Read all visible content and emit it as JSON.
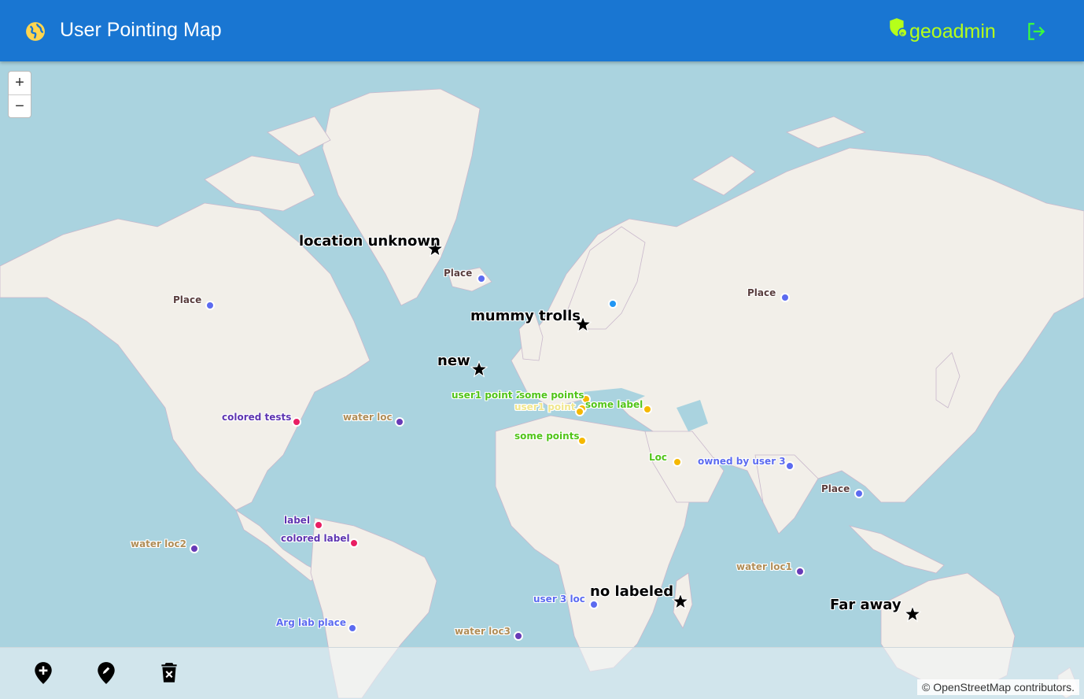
{
  "header": {
    "title": "User Pointing Map",
    "username": "geoadmin",
    "globe_icon": "globe-icon",
    "user_icon": "admin-badge-icon",
    "logout_icon": "logout-icon",
    "colors": {
      "bar": "#1976d2",
      "username": "#b6ff1a",
      "logout": "#3bff3b",
      "globe": "#ffd54f"
    }
  },
  "zoom": {
    "in": "+",
    "out": "−"
  },
  "markers": [
    {
      "label": "location unknown",
      "style": "star"
    },
    {
      "label": "Place",
      "style": "dot",
      "color": "#5c6bf0",
      "label_color": "#5a3e3e"
    },
    {
      "label": "Place",
      "style": "dot",
      "color": "#5c6bf0",
      "label_color": "#5a3e3e"
    },
    {
      "label": "mummy trolls",
      "style": "star"
    },
    {
      "label": "",
      "style": "dot",
      "color": "#2196f3"
    },
    {
      "label": "Place",
      "style": "dot",
      "color": "#5c6bf0",
      "label_color": "#5a3e3e"
    },
    {
      "label": "new",
      "style": "star"
    },
    {
      "label": "user1 point 2",
      "style": "dot",
      "color": "#f5b800",
      "label_color": "#52c41a"
    },
    {
      "label": "some points",
      "style": "dot",
      "color": "#f5b800",
      "label_color": "#52c41a"
    },
    {
      "label": "user1 point",
      "style": "dot",
      "color": "#f5b800",
      "label_color": "#f0e68c"
    },
    {
      "label": "some label",
      "style": "dot",
      "color": "#f5b800",
      "label_color": "#52c41a"
    },
    {
      "label": "colored tests",
      "style": "dot",
      "color": "#e91e63",
      "label_color": "#5e35b1"
    },
    {
      "label": "water loc",
      "style": "dot",
      "color": "#673ab7",
      "label_color": "#b08d57"
    },
    {
      "label": "some points",
      "style": "dot",
      "color": "#f5b800",
      "label_color": "#52c41a"
    },
    {
      "label": "Loc",
      "style": "dot",
      "color": "#f5b800",
      "label_color": "#52c41a"
    },
    {
      "label": "owned by user 3",
      "style": "dot",
      "color": "#5c6bf0",
      "label_color": "#5c6bf0"
    },
    {
      "label": "Place",
      "style": "dot",
      "color": "#5c6bf0",
      "label_color": "#5a3e3e"
    },
    {
      "label": "label",
      "style": "dot",
      "color": "#e91e63",
      "label_color": "#5e35b1"
    },
    {
      "label": "colored label",
      "style": "dot",
      "color": "#e91e63",
      "label_color": "#5e35b1"
    },
    {
      "label": "water loc2",
      "style": "dot",
      "color": "#673ab7",
      "label_color": "#b08d57"
    },
    {
      "label": "water loc1",
      "style": "dot",
      "color": "#673ab7",
      "label_color": "#b08d57"
    },
    {
      "label": "no labeled",
      "style": "star"
    },
    {
      "label": "user 3 loc",
      "style": "dot",
      "color": "#5c6bf0",
      "label_color": "#5c6bf0"
    },
    {
      "label": "Far away",
      "style": "star"
    },
    {
      "label": "Arg lab place",
      "style": "dot",
      "color": "#5c6bf0",
      "label_color": "#5c6bf0"
    },
    {
      "label": "water loc3",
      "style": "dot",
      "color": "#673ab7",
      "label_color": "#b08d57"
    }
  ],
  "toolbar": {
    "tools": [
      {
        "icon": "add-location-icon"
      },
      {
        "icon": "edit-location-icon"
      },
      {
        "icon": "delete-icon"
      }
    ]
  },
  "attribution": "© OpenStreetMap contributors."
}
